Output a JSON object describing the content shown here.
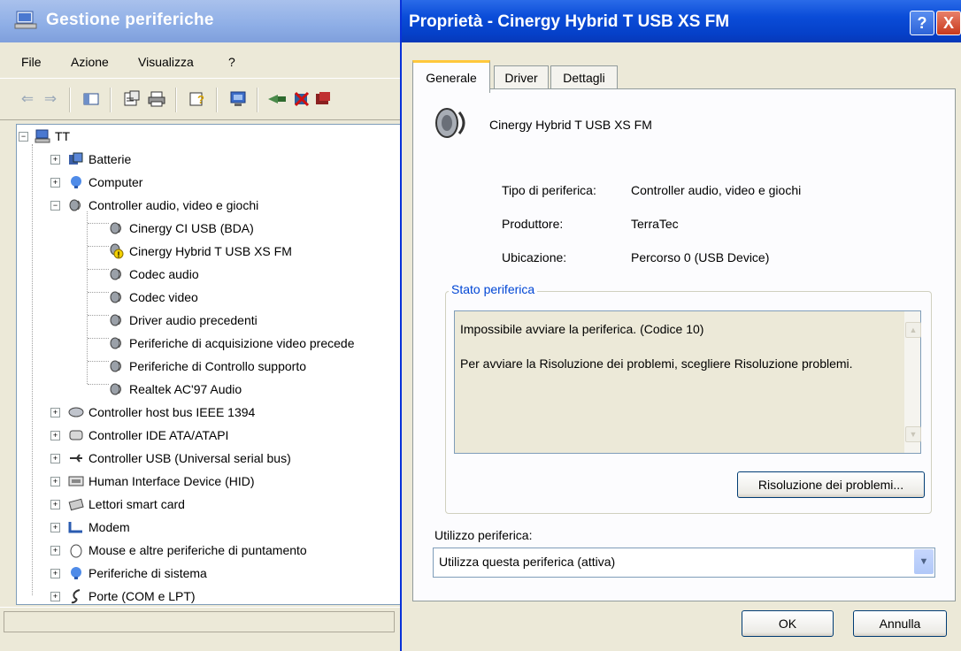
{
  "device_manager": {
    "title": "Gestione periferiche",
    "menu": [
      "File",
      "Azione",
      "Visualizza",
      "?"
    ],
    "tree": {
      "root": "TT",
      "items": [
        {
          "label": "Batterie",
          "icon": "battery-icon",
          "expanded": false
        },
        {
          "label": "Computer",
          "icon": "computer-icon",
          "expanded": false
        },
        {
          "label": "Controller audio, video e giochi",
          "icon": "audio-controller-icon",
          "expanded": true,
          "children": [
            {
              "label": "Cinergy CI USB (BDA)",
              "icon": "speaker-icon",
              "warning": false
            },
            {
              "label": "Cinergy Hybrid T USB XS FM",
              "icon": "speaker-warning-icon",
              "warning": true
            },
            {
              "label": "Codec audio",
              "icon": "speaker-icon",
              "warning": false
            },
            {
              "label": "Codec video",
              "icon": "speaker-icon",
              "warning": false
            },
            {
              "label": "Driver audio precedenti",
              "icon": "speaker-icon",
              "warning": false
            },
            {
              "label": "Periferiche di acquisizione video precede",
              "icon": "speaker-icon",
              "warning": false
            },
            {
              "label": "Periferiche di Controllo supporto",
              "icon": "speaker-icon",
              "warning": false
            },
            {
              "label": "Realtek AC'97 Audio",
              "icon": "speaker-icon",
              "warning": false
            }
          ]
        },
        {
          "label": "Controller host bus IEEE 1394",
          "icon": "firewire-icon",
          "expanded": false
        },
        {
          "label": "Controller IDE ATA/ATAPI",
          "icon": "ide-controller-icon",
          "expanded": false
        },
        {
          "label": "Controller USB (Universal serial bus)",
          "icon": "usb-icon",
          "expanded": false
        },
        {
          "label": "Human Interface Device (HID)",
          "icon": "hid-icon",
          "expanded": false
        },
        {
          "label": "Lettori smart card",
          "icon": "smart-card-icon",
          "expanded": false
        },
        {
          "label": "Modem",
          "icon": "modem-icon",
          "expanded": false
        },
        {
          "label": "Mouse e altre periferiche di puntamento",
          "icon": "mouse-icon",
          "expanded": false
        },
        {
          "label": "Periferiche di sistema",
          "icon": "system-device-icon",
          "expanded": false
        },
        {
          "label": "Porte (COM e LPT)",
          "icon": "port-icon",
          "expanded": false
        }
      ]
    }
  },
  "dialog": {
    "title": "Proprietà - Cinergy Hybrid T USB XS FM",
    "help_button": "?",
    "close_button": "X",
    "tabs": [
      "Generale",
      "Driver",
      "Dettagli"
    ],
    "active_tab": "Generale",
    "device_name": "Cinergy Hybrid T USB XS FM",
    "properties": [
      {
        "label": "Tipo di periferica:",
        "value": "Controller audio, video e giochi"
      },
      {
        "label": "Produttore:",
        "value": "TerraTec"
      },
      {
        "label": "Ubicazione:",
        "value": "Percorso 0 (USB Device)"
      }
    ],
    "status_group_title": "Stato periferica",
    "status_line1": "Impossibile avviare la periferica. (Codice 10)",
    "status_line2": "Per avviare la Risoluzione dei problemi, scegliere Risoluzione problemi.",
    "troubleshoot_button": "Risoluzione dei problemi...",
    "usage_label": "Utilizzo periferica:",
    "usage_value": "Utilizza questa periferica (attiva)",
    "ok_button": "OK",
    "cancel_button": "Annulla"
  }
}
